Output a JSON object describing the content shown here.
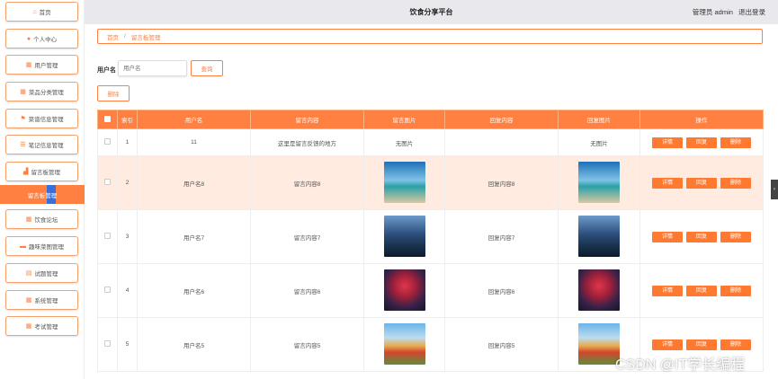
{
  "header": {
    "title": "饮食分享平台",
    "user_label": "管理员 admin",
    "logout_label": "退出登录"
  },
  "sidebar": {
    "items": [
      {
        "label": "首页",
        "icon": "home-icon"
      },
      {
        "label": "个人中心",
        "icon": "user-icon"
      },
      {
        "label": "用户管理",
        "icon": "grid-icon"
      },
      {
        "label": "菜品分类管理",
        "icon": "grid-icon"
      },
      {
        "label": "菜谱信息管理",
        "icon": "flag-icon"
      },
      {
        "label": "笔记信息管理",
        "icon": "list-icon"
      },
      {
        "label": "留言板管理",
        "icon": "chart-icon"
      },
      {
        "label": "饮食论坛",
        "icon": "grid-icon"
      },
      {
        "label": "趣味菜图管理",
        "icon": "image-icon"
      },
      {
        "label": "试题管理",
        "icon": "doc-icon"
      },
      {
        "label": "系统管理",
        "icon": "grid-icon"
      },
      {
        "label": "考试管理",
        "icon": "grid-icon"
      }
    ],
    "active_label": "留言板管理"
  },
  "breadcrumb": {
    "home": "首页",
    "current": "留言板管理"
  },
  "search": {
    "label": "用户名",
    "placeholder": "用户名",
    "button": "查询"
  },
  "toolbar": {
    "delete_label": "删除"
  },
  "table": {
    "headers": [
      "索引",
      "用户名",
      "留言内容",
      "留言图片",
      "回复内容",
      "回复图片",
      "操作"
    ],
    "actions": [
      "详情",
      "回复",
      "删除"
    ],
    "rows": [
      {
        "index": "1",
        "username": "11",
        "content": "这里是留言反馈的地方",
        "image": "无图片",
        "reply": "",
        "reply_image": "无图片"
      },
      {
        "index": "2",
        "username": "用户名8",
        "content": "留言内容8",
        "image_style": "img-a",
        "reply": "回复内容8",
        "reply_image_style": "img-a"
      },
      {
        "index": "3",
        "username": "用户名7",
        "content": "留言内容7",
        "image_style": "img-b",
        "reply": "回复内容7",
        "reply_image_style": "img-b"
      },
      {
        "index": "4",
        "username": "用户名6",
        "content": "留言内容6",
        "image_style": "img-c",
        "reply": "回复内容6",
        "reply_image_style": "img-c"
      },
      {
        "index": "5",
        "username": "用户名5",
        "content": "留言内容5",
        "image_style": "img-d",
        "reply": "回复内容5",
        "reply_image_style": "img-d"
      }
    ]
  },
  "watermark": "CSDN @IT学长编程",
  "colors": {
    "accent": "#ff8040",
    "highlight_row": "#ffebe0",
    "header_bg": "#e9e9ed"
  }
}
